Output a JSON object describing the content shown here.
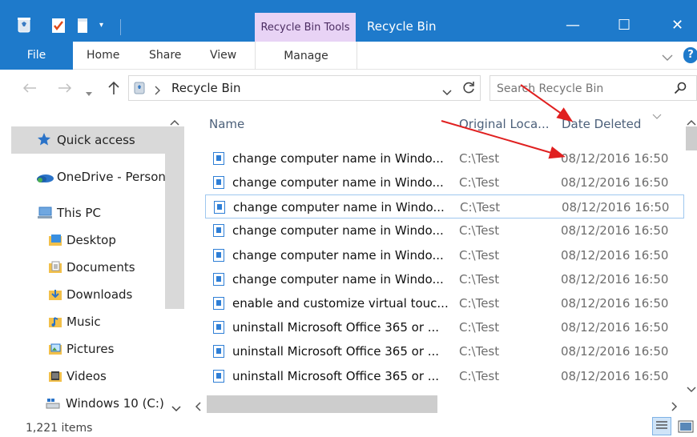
{
  "window": {
    "contextual_tab": "Recycle Bin Tools",
    "title": "Recycle Bin",
    "minimize": "—",
    "maximize": "☐",
    "close": "✕"
  },
  "ribbon": {
    "file": "File",
    "home": "Home",
    "share": "Share",
    "view": "View",
    "manage": "Manage",
    "help": "?"
  },
  "address": {
    "location": "Recycle Bin",
    "search_placeholder": "Search Recycle Bin"
  },
  "nav": {
    "quick_access": "Quick access",
    "onedrive": "OneDrive - Person",
    "this_pc": "This PC",
    "desktop": "Desktop",
    "documents": "Documents",
    "downloads": "Downloads",
    "music": "Music",
    "pictures": "Pictures",
    "videos": "Videos",
    "windows_c": "Windows 10 (C:)"
  },
  "columns": {
    "name": "Name",
    "original_location": "Original Loca...",
    "date_deleted": "Date Deleted"
  },
  "rows": [
    {
      "name": "change computer name in Windo...",
      "location": "C:\\Test",
      "date": "08/12/2016 16:50"
    },
    {
      "name": "change computer name in Windo...",
      "location": "C:\\Test",
      "date": "08/12/2016 16:50"
    },
    {
      "name": "change computer name in Windo...",
      "location": "C:\\Test",
      "date": "08/12/2016 16:50"
    },
    {
      "name": "change computer name in Windo...",
      "location": "C:\\Test",
      "date": "08/12/2016 16:50"
    },
    {
      "name": "change computer name in Windo...",
      "location": "C:\\Test",
      "date": "08/12/2016 16:50"
    },
    {
      "name": "change computer name in Windo...",
      "location": "C:\\Test",
      "date": "08/12/2016 16:50"
    },
    {
      "name": "enable and customize virtual touc...",
      "location": "C:\\Test",
      "date": "08/12/2016 16:50"
    },
    {
      "name": "uninstall Microsoft Office 365 or ...",
      "location": "C:\\Test",
      "date": "08/12/2016 16:50"
    },
    {
      "name": "uninstall Microsoft Office 365 or ...",
      "location": "C:\\Test",
      "date": "08/12/2016 16:50"
    },
    {
      "name": "uninstall Microsoft Office 365 or ...",
      "location": "C:\\Test",
      "date": "08/12/2016 16:50"
    }
  ],
  "status": {
    "item_count": "1,221 items"
  },
  "colors": {
    "titlebar": "#1e7acb",
    "contextual_tab": "#e8d3f5",
    "annotation_arrow": "#e02020"
  }
}
